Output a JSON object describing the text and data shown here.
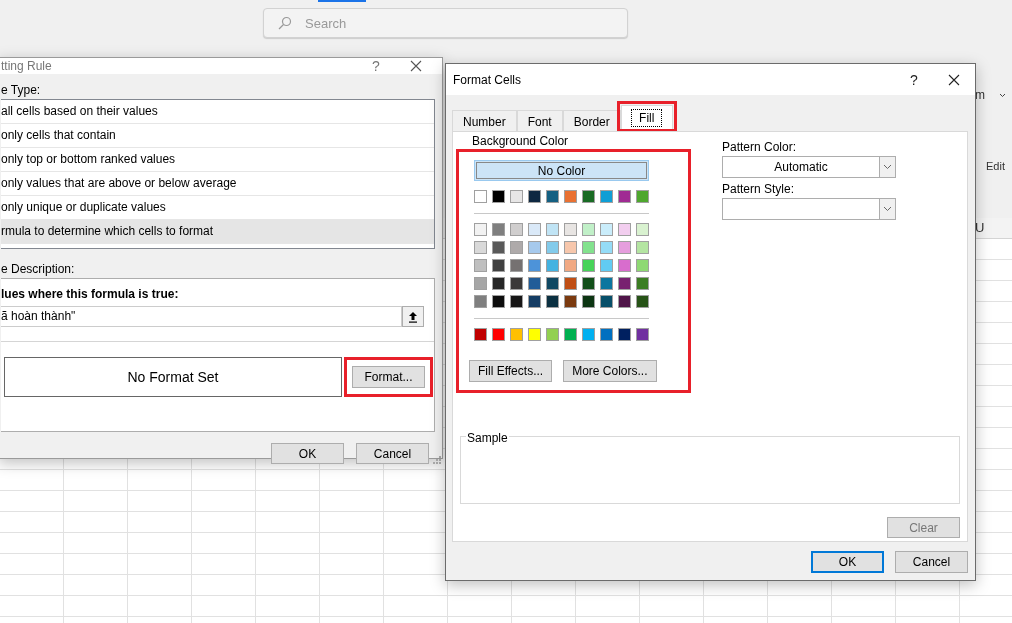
{
  "search": {
    "placeholder": "Search"
  },
  "ribbon": {
    "fragment_1": "m",
    "fragment_2": "Edit"
  },
  "sheet": {
    "column_header": "U"
  },
  "rule_dialog": {
    "title": "tting Rule",
    "help": "?",
    "type_label": "e Type:",
    "rule_types": [
      {
        "label": "all cells based on their values",
        "selected": false
      },
      {
        "label": "only cells that contain",
        "selected": false
      },
      {
        "label": "only top or bottom ranked values",
        "selected": false
      },
      {
        "label": "only values that are above or below average",
        "selected": false
      },
      {
        "label": "only unique or duplicate values",
        "selected": false
      },
      {
        "label": "rmula to determine which cells to format",
        "selected": true
      }
    ],
    "description_label": "e Description:",
    "formula_label": "lues where this formula is true:",
    "formula_value": "ã hoàn thành\"",
    "preview": "No Format Set",
    "format_button": {
      "label": "Format...",
      "highlighted": true
    },
    "buttons": [
      "OK",
      "Cancel"
    ]
  },
  "format_dialog": {
    "title": "Format Cells",
    "help": "?",
    "tabs": [
      {
        "label": "Number",
        "selected": false,
        "highlighted": false
      },
      {
        "label": "Font",
        "selected": false,
        "highlighted": false
      },
      {
        "label": "Border",
        "selected": false,
        "highlighted": false
      },
      {
        "label": "Fill",
        "selected": true,
        "highlighted": true
      }
    ],
    "fill": {
      "label": "Background Color",
      "highlighted": true,
      "no_color": "No Color",
      "theme_colors": [
        {
          "color": "#ffffff"
        },
        {
          "color": "#000000"
        },
        {
          "color": "#e7e6e6"
        },
        {
          "color": "#0e2841"
        },
        {
          "color": "#156082"
        },
        {
          "color": "#e97132"
        },
        {
          "color": "#196b24"
        },
        {
          "color": "#0f9ed5"
        },
        {
          "color": "#a02b93"
        },
        {
          "color": "#4ea72e"
        }
      ],
      "tint_rows": [
        {
          "swatches": [
            {
              "color": "#f2f2f2"
            },
            {
              "color": "#7f7f7f"
            },
            {
              "color": "#d0cece"
            },
            {
              "color": "#dae9f8"
            },
            {
              "color": "#c0e4f5"
            },
            {
              "color": "#e8e5e3"
            },
            {
              "color": "#c1f0c8"
            },
            {
              "color": "#caedfb"
            },
            {
              "color": "#f2ceef"
            },
            {
              "color": "#d9f2d0"
            }
          ]
        },
        {
          "swatches": [
            {
              "color": "#d9d9d9"
            },
            {
              "color": "#595959"
            },
            {
              "color": "#aeaaaa"
            },
            {
              "color": "#a6c9ec"
            },
            {
              "color": "#83cbeb"
            },
            {
              "color": "#f7c7ac"
            },
            {
              "color": "#83e28e"
            },
            {
              "color": "#95dcf7"
            },
            {
              "color": "#e59edd"
            },
            {
              "color": "#b4e5a2"
            }
          ]
        },
        {
          "swatches": [
            {
              "color": "#bfbfbf"
            },
            {
              "color": "#404040"
            },
            {
              "color": "#757171"
            },
            {
              "color": "#4d93d9"
            },
            {
              "color": "#44b3e1"
            },
            {
              "color": "#f1a983"
            },
            {
              "color": "#47d359"
            },
            {
              "color": "#61cbf3"
            },
            {
              "color": "#d86dcd"
            },
            {
              "color": "#8ed973"
            }
          ]
        },
        {
          "swatches": [
            {
              "color": "#a6a6a6"
            },
            {
              "color": "#262626"
            },
            {
              "color": "#3a3838"
            },
            {
              "color": "#215c98"
            },
            {
              "color": "#104862"
            },
            {
              "color": "#c04f15"
            },
            {
              "color": "#124f1a"
            },
            {
              "color": "#0b769f"
            },
            {
              "color": "#782170"
            },
            {
              "color": "#3b7d23"
            }
          ]
        },
        {
          "swatches": [
            {
              "color": "#7f7f7f"
            },
            {
              "color": "#0d0d0d"
            },
            {
              "color": "#171616"
            },
            {
              "color": "#153d64"
            },
            {
              "color": "#0b3041"
            },
            {
              "color": "#7b3a0f"
            },
            {
              "color": "#0c3512"
            },
            {
              "color": "#074f69"
            },
            {
              "color": "#501549"
            },
            {
              "color": "#275317"
            }
          ]
        }
      ],
      "standard_colors": [
        {
          "color": "#c00000"
        },
        {
          "color": "#ff0000"
        },
        {
          "color": "#ffc000"
        },
        {
          "color": "#ffff00"
        },
        {
          "color": "#92d050"
        },
        {
          "color": "#00b050"
        },
        {
          "color": "#00b0f0"
        },
        {
          "color": "#0070c0"
        },
        {
          "color": "#002060"
        },
        {
          "color": "#7030a0"
        }
      ],
      "buttons": [
        "Fill Effects...",
        "More Colors..."
      ]
    },
    "pattern_color": {
      "label": "Pattern Color:",
      "value": "Automatic"
    },
    "pattern_style": {
      "label": "Pattern Style:"
    },
    "sample": {
      "label": "Sample"
    },
    "clear_button": {
      "label": "Clear",
      "disabled": true
    },
    "buttons": [
      {
        "label": "OK",
        "default": true
      },
      {
        "label": "Cancel",
        "default": false
      }
    ]
  }
}
